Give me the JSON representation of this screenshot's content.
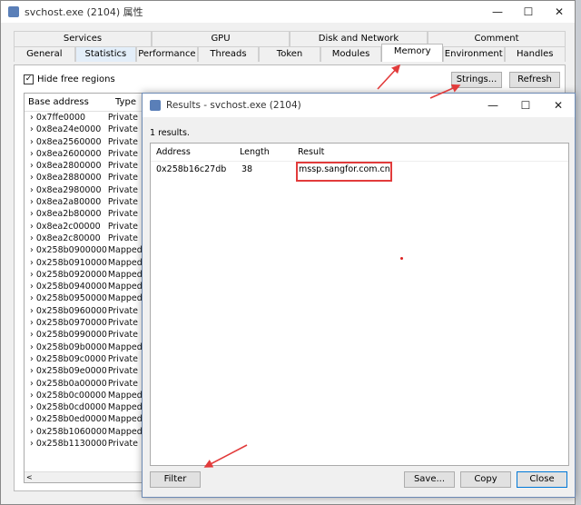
{
  "window": {
    "title": "svchost.exe (2104) 属性",
    "tabs_top": [
      "Services",
      "GPU",
      "Disk and Network",
      "Comment"
    ],
    "tabs_bottom": [
      "General",
      "Statistics",
      "Performance",
      "Threads",
      "Token",
      "Modules",
      "Memory",
      "Environment",
      "Handles"
    ],
    "active_tab": "Memory"
  },
  "memory": {
    "hide_free_label": "Hide free regions",
    "hide_free_checked": "✓",
    "strings_button": "Strings...",
    "refresh_button": "Refresh",
    "columns": [
      "Base address",
      "Type"
    ],
    "rows": [
      {
        "addr": "0x7ffe0000",
        "type": "Private"
      },
      {
        "addr": "0x8ea24e0000",
        "type": "Private"
      },
      {
        "addr": "0x8ea2560000",
        "type": "Private"
      },
      {
        "addr": "0x8ea2600000",
        "type": "Private"
      },
      {
        "addr": "0x8ea2800000",
        "type": "Private"
      },
      {
        "addr": "0x8ea2880000",
        "type": "Private"
      },
      {
        "addr": "0x8ea2980000",
        "type": "Private"
      },
      {
        "addr": "0x8ea2a80000",
        "type": "Private"
      },
      {
        "addr": "0x8ea2b80000",
        "type": "Private"
      },
      {
        "addr": "0x8ea2c00000",
        "type": "Private"
      },
      {
        "addr": "0x8ea2c80000",
        "type": "Private"
      },
      {
        "addr": "0x258b0900000",
        "type": "Mapped"
      },
      {
        "addr": "0x258b0910000",
        "type": "Mapped"
      },
      {
        "addr": "0x258b0920000",
        "type": "Mapped"
      },
      {
        "addr": "0x258b0940000",
        "type": "Mapped"
      },
      {
        "addr": "0x258b0950000",
        "type": "Mapped"
      },
      {
        "addr": "0x258b0960000",
        "type": "Private"
      },
      {
        "addr": "0x258b0970000",
        "type": "Private"
      },
      {
        "addr": "0x258b0990000",
        "type": "Private"
      },
      {
        "addr": "0x258b09b0000",
        "type": "Mapped"
      },
      {
        "addr": "0x258b09c0000",
        "type": "Private"
      },
      {
        "addr": "0x258b09e0000",
        "type": "Private"
      },
      {
        "addr": "0x258b0a00000",
        "type": "Private"
      },
      {
        "addr": "0x258b0c00000",
        "type": "Mapped"
      },
      {
        "addr": "0x258b0cd0000",
        "type": "Mapped"
      },
      {
        "addr": "0x258b0ed0000",
        "type": "Mapped"
      },
      {
        "addr": "0x258b1060000",
        "type": "Mapped"
      },
      {
        "addr": "0x258b1130000",
        "type": "Private"
      }
    ]
  },
  "dialog": {
    "title": "Results - svchost.exe (2104)",
    "count": "1 results.",
    "columns": [
      "Address",
      "Length",
      "Result"
    ],
    "result": {
      "address": "0x258b16c27db",
      "length": "38",
      "result": "mssp.sangfor.com.cn"
    },
    "filter_button": "Filter",
    "save_button": "Save...",
    "copy_button": "Copy",
    "close_button": "Close"
  },
  "colors": {
    "highlight": "#e23b3b",
    "accent": "#0078d7"
  }
}
